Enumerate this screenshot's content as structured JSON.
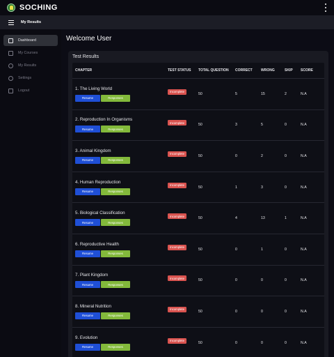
{
  "app": {
    "brand": "SOCHING"
  },
  "header": {
    "title": "My Results"
  },
  "sidebar": {
    "items": [
      {
        "label": "Dashboard",
        "icon": "home-icon",
        "active": true
      },
      {
        "label": "My Courses",
        "icon": "book-icon",
        "active": false
      },
      {
        "label": "My Results",
        "icon": "medal-icon",
        "active": false
      },
      {
        "label": "Settings",
        "icon": "gear-icon",
        "active": false
      },
      {
        "label": "Logout",
        "icon": "logout-icon",
        "active": false
      }
    ]
  },
  "main": {
    "welcome": "Welcome User",
    "card_title": "Test Results",
    "columns": [
      "CHAPTER",
      "TEST STATUS",
      "TOTAL QUESTION",
      "CORRECT",
      "WRONG",
      "SKIP",
      "SCORE"
    ],
    "rows": [
      {
        "chapter": "1. The Living World",
        "status": "Incomplete",
        "total": "50",
        "correct": "5",
        "wrong": "15",
        "skip": "2",
        "score": "N.A"
      },
      {
        "chapter": "2. Reproduction In Organisms",
        "status": "Incomplete",
        "total": "50",
        "correct": "3",
        "wrong": "5",
        "skip": "0",
        "score": "N.A"
      },
      {
        "chapter": "3. Animal Kingdom",
        "status": "Incomplete",
        "total": "50",
        "correct": "0",
        "wrong": "2",
        "skip": "0",
        "score": "N.A"
      },
      {
        "chapter": "4. Human Reproduction",
        "status": "Incomplete",
        "total": "50",
        "correct": "1",
        "wrong": "3",
        "skip": "0",
        "score": "N.A"
      },
      {
        "chapter": "5. Biological Classification",
        "status": "Incomplete",
        "total": "50",
        "correct": "4",
        "wrong": "13",
        "skip": "1",
        "score": "N.A"
      },
      {
        "chapter": "6. Reproductive Health",
        "status": "Incomplete",
        "total": "50",
        "correct": "0",
        "wrong": "1",
        "skip": "0",
        "score": "N.A"
      },
      {
        "chapter": "7. Plant Kingdom",
        "status": "Incomplete",
        "total": "50",
        "correct": "0",
        "wrong": "0",
        "skip": "0",
        "score": "N.A"
      },
      {
        "chapter": "8. Mineral Nutrition",
        "status": "Incomplete",
        "total": "50",
        "correct": "0",
        "wrong": "0",
        "skip": "0",
        "score": "N.A"
      },
      {
        "chapter": "9. Evolution",
        "status": "Incomplete",
        "total": "50",
        "correct": "0",
        "wrong": "0",
        "skip": "0",
        "score": "N.A"
      }
    ],
    "buttons": {
      "resume": "Resume",
      "responses": "Responses"
    }
  },
  "colors": {
    "resume": "#1f4fd6",
    "responses": "#83b93b",
    "badge": "#d9534f",
    "active_nav": "#2f3138"
  }
}
